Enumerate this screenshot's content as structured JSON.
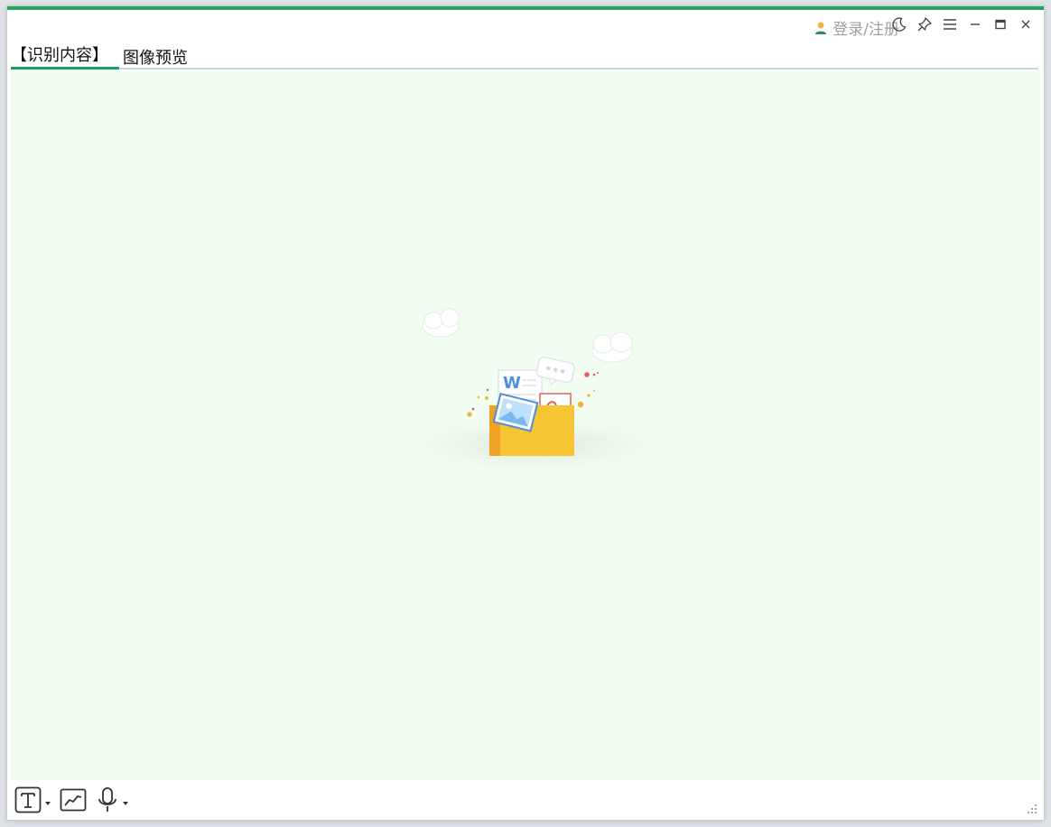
{
  "header": {
    "login_label": "登录/注册",
    "user_icon": "user-icon"
  },
  "window_controls": {
    "items": [
      "moon-icon",
      "pin-icon",
      "menu-icon",
      "minimize-icon",
      "maximize-icon",
      "close-icon"
    ]
  },
  "tabs": [
    {
      "label": "【识别内容】",
      "active": true
    },
    {
      "label": "图像预览",
      "active": false
    }
  ],
  "empty_state": {
    "illustration": "empty-folder-illustration"
  },
  "bottom_toolbar": {
    "tools": [
      "text-tool-icon",
      "chart-tool-icon",
      "microphone-tool-icon"
    ]
  },
  "colors": {
    "accent": "#1faa5c",
    "tab_underline": "#16a35a",
    "content_bg": "#f0fdf0",
    "folder_yellow": "#f5c533",
    "folder_orange": "#f2a127"
  }
}
